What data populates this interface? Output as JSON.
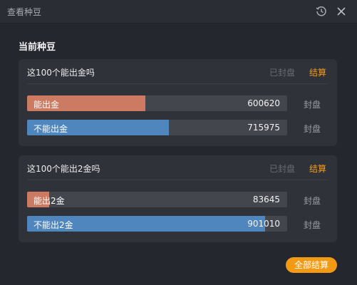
{
  "window": {
    "title": "查看种豆",
    "history_icon": "history-icon",
    "close_icon": "close-icon"
  },
  "section_title": "当前种豆",
  "colors": {
    "accent": "#f39a14",
    "option_a": "#cd7a62",
    "option_b": "#4f86bd"
  },
  "cards": [
    {
      "question": "这100个能出金吗",
      "status": "已封盘",
      "settle_label": "结算",
      "options": [
        {
          "label": "能出金",
          "value": "600620",
          "fill_percent": 45.5,
          "color": "orange",
          "action": "封盘"
        },
        {
          "label": "不能出金",
          "value": "715975",
          "fill_percent": 54.5,
          "color": "blue",
          "action": "封盘"
        }
      ]
    },
    {
      "question": "这100个能出2金吗",
      "status": "已封盘",
      "settle_label": "结算",
      "options": [
        {
          "label": "能出2金",
          "value": "83645",
          "fill_percent": 8.5,
          "color": "orange",
          "action": "封盘"
        },
        {
          "label": "不能出2金",
          "value": "901010",
          "fill_percent": 91.5,
          "color": "blue",
          "action": "封盘"
        }
      ]
    }
  ],
  "settle_all_label": "全部结算"
}
